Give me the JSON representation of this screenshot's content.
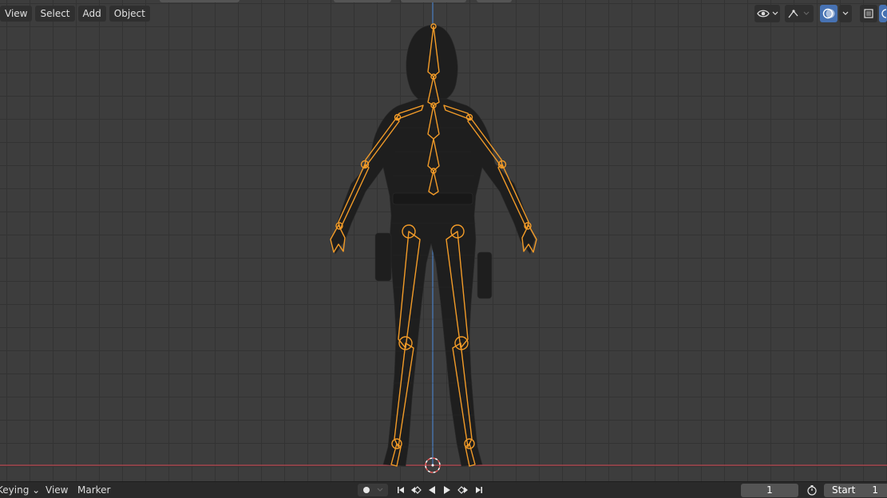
{
  "header_menu": {
    "view": "View",
    "select": "Select",
    "add": "Add",
    "object": "Object"
  },
  "viewport_tools": {
    "visibility_icon": "eye-icon",
    "gizmo_icon": "gizmo-icon",
    "overlay_icon": "overlay-icon",
    "xray_icon": "xray-icon",
    "shading_icon": "shading-icon"
  },
  "colors": {
    "armature": "#f29b28",
    "grid_bg": "#3d3d3d",
    "x_axis": "#c0464e",
    "z_axis": "#4a7ec2",
    "active_button": "#4772b3"
  },
  "timeline": {
    "keying": "Keying",
    "view": "View",
    "marker": "Marker",
    "current_frame": "1",
    "start_label": "Start",
    "start_value": "1"
  }
}
